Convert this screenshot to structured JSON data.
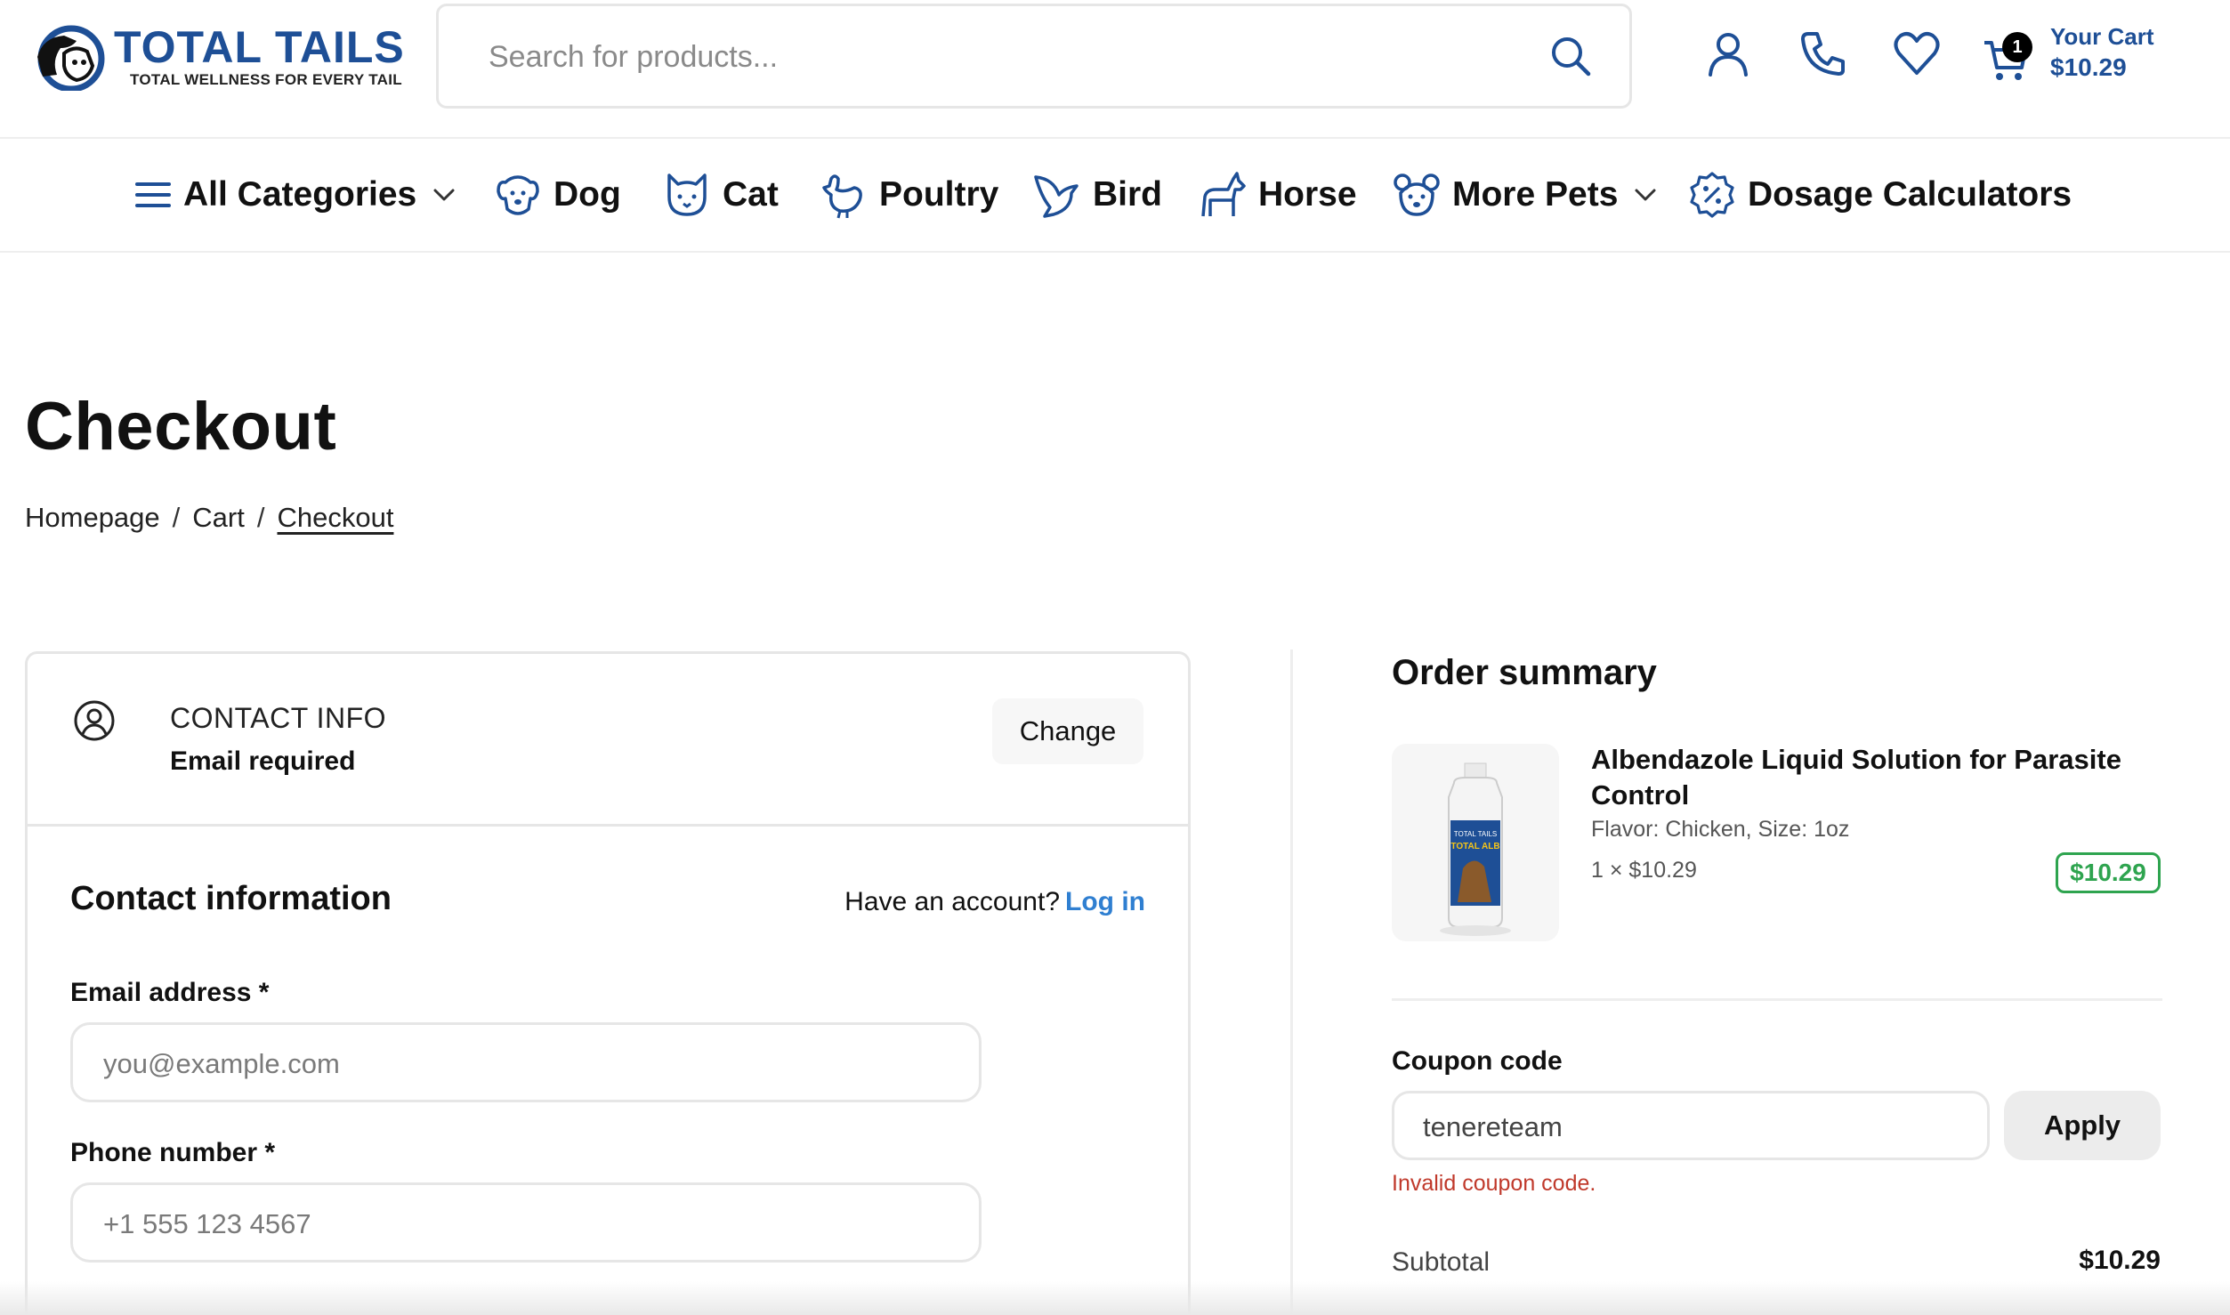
{
  "header": {
    "logo_title": "TOTAL TAILS",
    "logo_tagline": "TOTAL WELLNESS FOR EVERY TAIL",
    "search_placeholder": "Search for products...",
    "cart_count": "1",
    "cart_label": "Your Cart",
    "cart_total": "$10.29"
  },
  "nav": {
    "items": [
      {
        "label": "All Categories",
        "icon": "menu-icon",
        "has_dropdown": true
      },
      {
        "label": "Dog",
        "icon": "dog-icon"
      },
      {
        "label": "Cat",
        "icon": "cat-icon"
      },
      {
        "label": "Poultry",
        "icon": "poultry-icon"
      },
      {
        "label": "Bird",
        "icon": "bird-icon"
      },
      {
        "label": "Horse",
        "icon": "horse-icon"
      },
      {
        "label": "More Pets",
        "icon": "more-pets-icon",
        "has_dropdown": true
      },
      {
        "label": "Dosage Calculators",
        "icon": "dosage-calculator-icon"
      }
    ]
  },
  "page": {
    "title": "Checkout",
    "breadcrumb": [
      "Homepage",
      "Cart",
      "Checkout"
    ],
    "breadcrumb_sep": "/"
  },
  "contact_card": {
    "label": "CONTACT INFO",
    "status": "Email required",
    "change_label": "Change",
    "section_title": "Contact information",
    "have_account": "Have an account?",
    "login_label": "Log in",
    "email_label": "Email address *",
    "email_placeholder": "you@example.com",
    "phone_label": "Phone number *",
    "phone_placeholder": "+1 555 123 4567"
  },
  "order_summary": {
    "title": "Order summary",
    "product_name": "Albendazole Liquid Solution for Parasite Control",
    "product_variant": "Flavor: Chicken, Size: 1oz",
    "product_qty": "1 × $10.29",
    "product_price": "$10.29",
    "bottle_label_top": "TOTAL TAILS",
    "bottle_label_main": "TOTAL ALB",
    "coupon_label": "Coupon code",
    "coupon_value": "tenereteam",
    "apply_label": "Apply",
    "coupon_error": "Invalid coupon code.",
    "subtotal_label": "Subtotal",
    "subtotal_value": "$10.29"
  },
  "colors": {
    "brand_blue": "#1e4f96",
    "link_blue": "#2f7fd1",
    "price_green": "#2ea44f",
    "error_red": "#c0392b"
  }
}
